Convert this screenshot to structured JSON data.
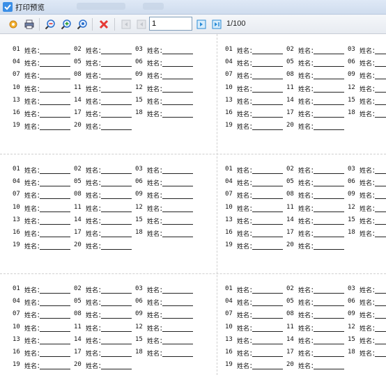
{
  "window": {
    "title": "打印预览"
  },
  "toolbar": {
    "buttons": [
      {
        "name": "settings-icon"
      },
      {
        "name": "printer-icon"
      },
      {
        "name": "zoom-out-icon"
      },
      {
        "name": "zoom-in-icon"
      },
      {
        "name": "zoom-fit-icon"
      },
      {
        "name": "close-icon"
      },
      {
        "name": "first-page-icon"
      },
      {
        "name": "prev-page-icon"
      },
      {
        "name": "next-page-icon"
      },
      {
        "name": "last-page-icon"
      }
    ],
    "page_value": "1",
    "page_total": "1/100",
    "colors": {
      "close": "#e53935",
      "nav_active": "#2a8bd6"
    }
  },
  "label_field_text": "姓名：",
  "blocks": [
    {
      "labels": [
        "01",
        "02",
        "03",
        "04",
        "05",
        "06",
        "07",
        "08",
        "09",
        "10",
        "11",
        "12",
        "13",
        "14",
        "15",
        "16",
        "17",
        "18",
        "19",
        "20"
      ]
    },
    {
      "labels": [
        "01",
        "02",
        "03",
        "04",
        "05",
        "06",
        "07",
        "08",
        "09",
        "10",
        "11",
        "12",
        "13",
        "14",
        "15",
        "16",
        "17",
        "18",
        "19",
        "20"
      ]
    },
    {
      "labels": [
        "01",
        "02",
        "03",
        "04",
        "05",
        "06",
        "07",
        "08",
        "09",
        "10",
        "11",
        "12",
        "13",
        "14",
        "15",
        "16",
        "17",
        "18",
        "19",
        "20"
      ]
    },
    {
      "labels": [
        "01",
        "02",
        "03",
        "04",
        "05",
        "06",
        "07",
        "08",
        "09",
        "10",
        "11",
        "12",
        "13",
        "14",
        "15",
        "16",
        "17",
        "18",
        "19",
        "20"
      ]
    },
    {
      "labels": [
        "01",
        "02",
        "03",
        "04",
        "05",
        "06",
        "07",
        "08",
        "09",
        "10",
        "11",
        "12",
        "13",
        "14",
        "15",
        "16",
        "17",
        "18",
        "19",
        "20"
      ]
    },
    {
      "labels": [
        "01",
        "02",
        "03",
        "04",
        "05",
        "06",
        "07",
        "08",
        "09",
        "10",
        "11",
        "12",
        "13",
        "14",
        "15",
        "16",
        "17",
        "18",
        "19",
        "20"
      ]
    }
  ]
}
